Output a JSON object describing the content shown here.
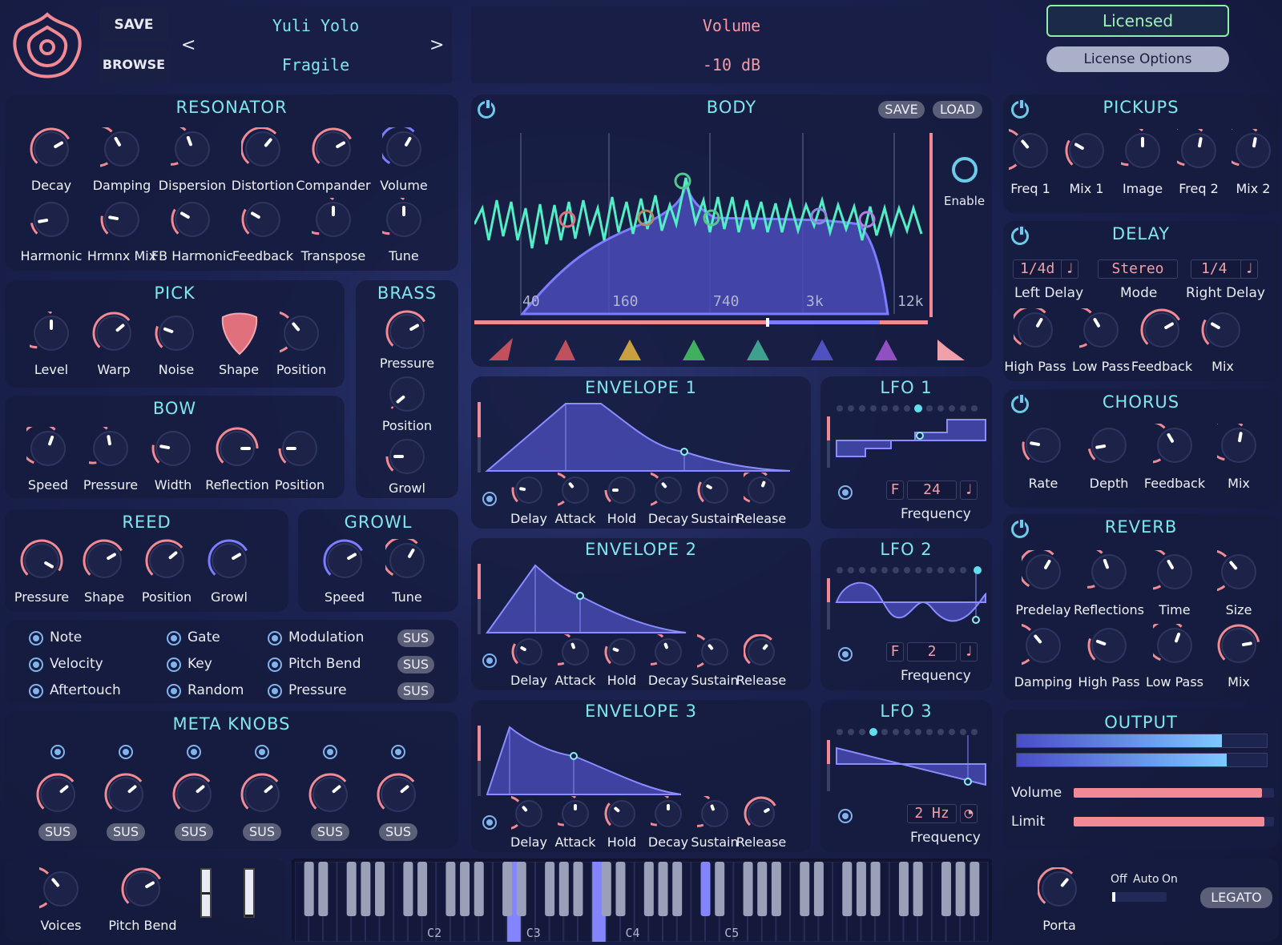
{
  "header": {
    "save": "SAVE",
    "browse": "BROWSE",
    "prev": "<",
    "next": ">",
    "preset_author": "Yuli Yolo",
    "preset_name": "Fragile",
    "param_name": "Volume",
    "param_value": "-10 dB",
    "licensed": "Licensed",
    "license_options": "License Options"
  },
  "resonator": {
    "title": "RESONATOR",
    "labels": [
      "Decay",
      "Damping",
      "Dispersion",
      "Distortion",
      "Compander",
      "Volume",
      "Harmonic",
      "Hrmnx Mix",
      "FB Harmonic",
      "Feedback",
      "Transpose",
      "Tune"
    ]
  },
  "pick": {
    "title": "PICK",
    "labels": [
      "Level",
      "Warp",
      "Noise",
      "Shape",
      "Position"
    ]
  },
  "brass": {
    "title": "BRASS",
    "labels": [
      "Pressure",
      "Position",
      "Growl"
    ]
  },
  "bow": {
    "title": "BOW",
    "labels": [
      "Speed",
      "Pressure",
      "Width",
      "Reflection",
      "Position"
    ]
  },
  "reed": {
    "title": "REED",
    "labels": [
      "Pressure",
      "Shape",
      "Position",
      "Growl"
    ]
  },
  "growl": {
    "title": "GROWL",
    "labels": [
      "Speed",
      "Tune"
    ]
  },
  "mod_sources": {
    "col1": [
      "Note",
      "Velocity",
      "Aftertouch"
    ],
    "col2": [
      "Gate",
      "Key",
      "Random"
    ],
    "col3": [
      "Modulation",
      "Pitch Bend",
      "Pressure"
    ],
    "sus": "SUS"
  },
  "meta": {
    "title": "META KNOBS",
    "sus": "SUS"
  },
  "body": {
    "title": "BODY",
    "save": "SAVE",
    "load": "LOAD",
    "enable": "Enable",
    "freq_labels": [
      "40",
      "160",
      "740",
      "3k",
      "12k"
    ]
  },
  "env1": {
    "title": "ENVELOPE 1"
  },
  "env2": {
    "title": "ENVELOPE 2"
  },
  "env3": {
    "title": "ENVELOPE 3"
  },
  "env_labels": [
    "Delay",
    "Attack",
    "Hold",
    "Decay",
    "Sustain",
    "Release"
  ],
  "lfo1": {
    "title": "LFO 1",
    "value": "24",
    "freq": "Frequency"
  },
  "lfo2": {
    "title": "LFO 2",
    "value": "2",
    "freq": "Frequency"
  },
  "lfo3": {
    "title": "LFO 3",
    "value": "2 Hz",
    "freq": "Frequency"
  },
  "lfo_f": "F",
  "pickups": {
    "title": "PICKUPS",
    "labels": [
      "Freq 1",
      "Mix 1",
      "Image",
      "Freq 2",
      "Mix 2"
    ]
  },
  "delay": {
    "title": "DELAY",
    "left": "1/4d",
    "mode": "Stereo",
    "right": "1/4",
    "labels1": [
      "Left Delay",
      "Mode",
      "Right Delay"
    ],
    "labels2": [
      "High Pass",
      "Low Pass",
      "Feedback",
      "Mix"
    ]
  },
  "chorus": {
    "title": "CHORUS",
    "labels": [
      "Rate",
      "Depth",
      "Feedback",
      "Mix"
    ]
  },
  "reverb": {
    "title": "REVERB",
    "labels": [
      "Predelay",
      "Reflections",
      "Time",
      "Size",
      "Damping",
      "High Pass",
      "Low Pass",
      "Mix"
    ]
  },
  "output": {
    "title": "OUTPUT",
    "volume": "Volume",
    "limit": "Limit",
    "volume_level": 0.94,
    "limit_level": 0.95,
    "meter1": 0.82,
    "meter2": 0.84
  },
  "bottom": {
    "voices": "Voices",
    "pitch_bend": "Pitch Bend",
    "porta": "Porta",
    "off": "Off",
    "auto": "Auto",
    "on": "On",
    "legato": "LEGATO",
    "octaves": [
      "C2",
      "C3",
      "C4",
      "C5"
    ]
  },
  "colors": {
    "accent": "#7ee6ef",
    "knob_arc": "#f08090",
    "active_arc": "#7b7cff"
  }
}
